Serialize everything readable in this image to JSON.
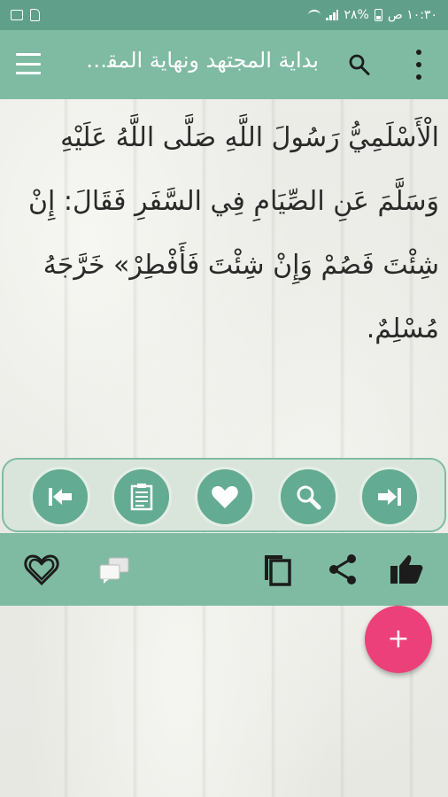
{
  "status_bar": {
    "time": "١٠:٣٠ ص",
    "battery_percent": "%٢٨",
    "icons": [
      "wifi-icon",
      "signal-icon",
      "battery-icon",
      "sim-icon",
      "image-icon"
    ]
  },
  "app_bar": {
    "title": "بداية المجتهد ونهاية المقتصد",
    "icons": [
      "menu-icon",
      "search-icon",
      "more-vert-icon"
    ]
  },
  "content": {
    "lines": [
      "الْأَسْلَمِيُّ رَسُولَ اللَّهِ صَلَّى اللَّهُ عَلَيْهِ",
      "وَسَلَّمَ عَنِ الصِّيَامِ فِي السَّفَرِ فَقَالَ: إِنْ",
      "شِئْتَ فَصُمْ وَإِنْ شِئْتَ فَأَفْطِرْ» خَرَّجَهُ",
      "مُسْلِمٌ."
    ]
  },
  "nav_toolbar": {
    "buttons": [
      "first-page-icon",
      "contents-icon",
      "favorite-icon",
      "search-zoom-icon",
      "last-page-icon"
    ]
  },
  "action_bar": {
    "buttons": [
      "favorite-outline-icon",
      "comments-icon",
      "copy-icon",
      "share-icon",
      "thumb-up-icon"
    ]
  },
  "fab": {
    "label": "+"
  },
  "colors": {
    "status_bar": "#60a08a",
    "app_bar": "#7fbba3",
    "button_fill": "#64ab93",
    "toolbar_bg": "#d9e5da",
    "fab": "#ec407a"
  }
}
